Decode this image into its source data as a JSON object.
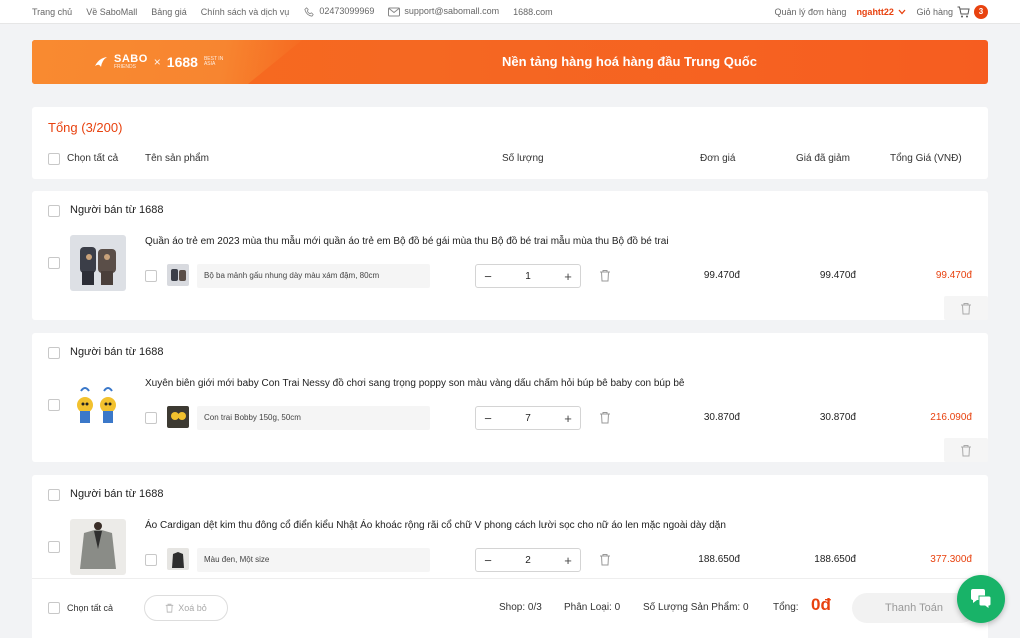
{
  "nav": {
    "links": [
      "Trang chủ",
      "Về SaboMall",
      "Bảng giá",
      "Chính sách và dịch vụ"
    ],
    "phone": "02473099969",
    "email": "support@sabomall.com",
    "site": "1688.com",
    "order_mgmt": "Quản lý đơn hàng",
    "username": "ngahtt22",
    "cart_label": "Giỏ hàng",
    "cart_count": "3"
  },
  "banner": {
    "brand": "SABO",
    "brand_sub": "FRIENDS",
    "times": "×",
    "partner": "1688",
    "partner_sub": "BEST IN ASIA",
    "slogan": "Nền tảng hàng hoá hàng đầu Trung Quốc"
  },
  "header": {
    "total": "Tổng (3/200)",
    "select_all": "Chọn tất cả",
    "col_name": "Tên sản phẩm",
    "col_qty": "Số lượng",
    "col_unit": "Đơn giá",
    "col_discount": "Giá đã giảm",
    "col_total": "Tổng Giá  (VNĐ)"
  },
  "sellers": [
    {
      "name": "Người bán từ 1688",
      "title": "Quần áo trẻ em 2023 mùa thu mẫu mới quần áo trẻ em Bộ đồ bé gái mùa thu Bộ đồ bé trai mẫu mùa thu Bộ đồ bé trai",
      "variant": "Bộ ba mảnh gấu nhung dày màu xám đậm, 80cm",
      "qty": "1",
      "unit_price": "99.470đ",
      "discount_price": "99.470đ",
      "total": "99.470đ"
    },
    {
      "name": "Người bán từ 1688",
      "title": "Xuyên biên giới mới baby Con Trai Nessy đồ chơi sang trọng poppy son màu vàng dấu chấm hỏi búp bê baby con búp bê",
      "variant": "Con trai Bobby 150g, 50cm",
      "qty": "7",
      "unit_price": "30.870đ",
      "discount_price": "30.870đ",
      "total": "216.090đ"
    },
    {
      "name": "Người bán từ 1688",
      "title": "Áo Cardigan dệt kim thu đông cổ điển kiểu Nhật Áo khoác rộng rãi cổ chữ V phong cách lười sọc cho nữ áo len mặc ngoài dày dặn",
      "variant": "Màu đen, Một size",
      "qty": "2",
      "unit_price": "188.650đ",
      "discount_price": "188.650đ",
      "total": "377.300đ"
    }
  ],
  "footer": {
    "select_all": "Chọn tất cả",
    "delete": "Xoá bỏ",
    "shop": "Shop: 0/3",
    "category": "Phân Loại: 0",
    "product_qty": "Số Lượng Sản Phẩm: 0",
    "total_label": "Tổng:",
    "total_value": "0đ",
    "pay": "Thanh Toán"
  },
  "colors": {
    "accent": "#e8420f",
    "banner": "#f76a1c",
    "chat": "#18b368"
  }
}
